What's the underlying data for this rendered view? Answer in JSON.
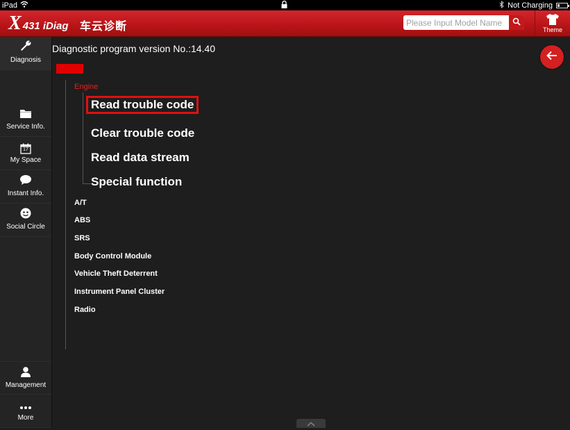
{
  "status_bar": {
    "device": "iPad",
    "battery_text": "Not Charging"
  },
  "header": {
    "logo_x": "X",
    "logo_text": "431 iDiag",
    "app_title": "车云诊断",
    "search_placeholder": "Please Input Model Name",
    "theme_label": "Theme"
  },
  "sidebar": {
    "items": [
      {
        "label": "Diagnosis",
        "icon": "wrench-icon"
      },
      {
        "label": "Service Info.",
        "icon": "folder-icon"
      },
      {
        "label": "My Space",
        "icon": "calendar-icon"
      },
      {
        "label": "Instant Info.",
        "icon": "chat-bubble-icon"
      },
      {
        "label": "Social Circle",
        "icon": "smiley-icon"
      },
      {
        "label": "Management",
        "icon": "user-icon"
      },
      {
        "label": "More",
        "icon": "more-dots-icon"
      }
    ],
    "calendar_day": "17"
  },
  "main": {
    "version_text": "Diagnostic program version No.:14.40",
    "tree": {
      "selected_system": "Engine",
      "engine_functions": [
        "Read trouble code",
        "Clear trouble code",
        "Read data stream",
        "Special function"
      ],
      "systems": [
        "A/T",
        "ABS",
        "SRS",
        "Body Control Module",
        "Vehicle Theft Deterrent",
        "Instrument Panel Cluster",
        "Radio"
      ]
    }
  },
  "colors": {
    "brand_red": "#c4181c",
    "highlight_red": "#e01010",
    "background": "#1e1e1e"
  }
}
